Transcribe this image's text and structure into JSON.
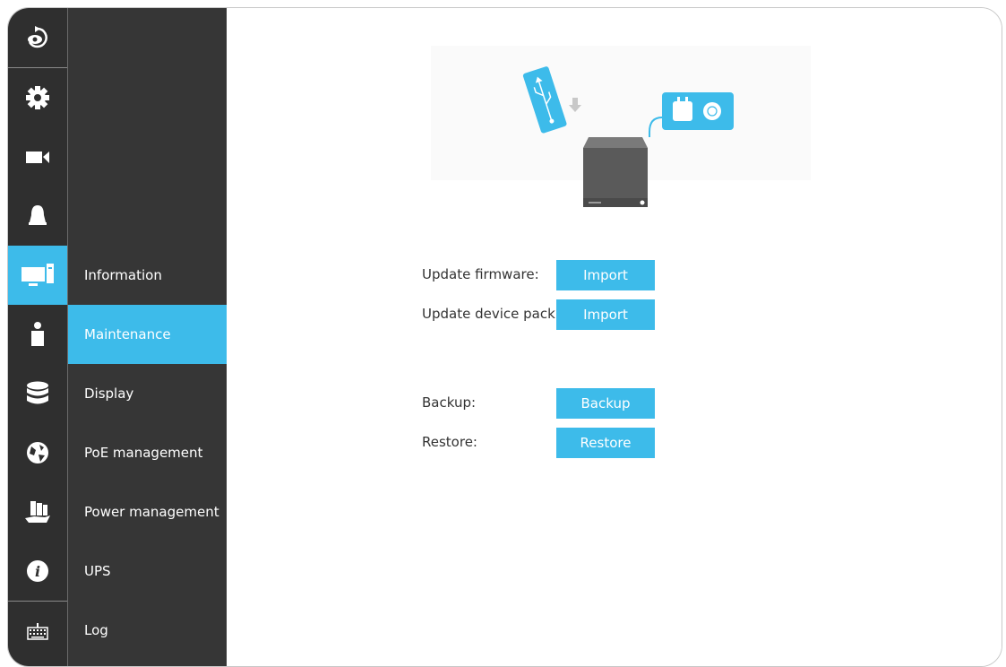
{
  "rail": {
    "items": [
      {
        "icon": "back-eye-icon"
      },
      {
        "icon": "gear-icon"
      },
      {
        "icon": "video-camera-icon"
      },
      {
        "icon": "bell-icon"
      },
      {
        "icon": "computer-icon"
      },
      {
        "icon": "user-icon"
      },
      {
        "icon": "database-icon"
      },
      {
        "icon": "globe-icon"
      },
      {
        "icon": "storage-hand-icon"
      },
      {
        "icon": "info-icon"
      },
      {
        "icon": "keyboard-icon"
      }
    ],
    "active_index": 4
  },
  "submenu": {
    "items": [
      {
        "label": "Information"
      },
      {
        "label": "Maintenance"
      },
      {
        "label": "Display"
      },
      {
        "label": "PoE management"
      },
      {
        "label": "Power management"
      },
      {
        "label": "UPS"
      },
      {
        "label": "Log"
      }
    ],
    "active_index": 1
  },
  "maintenance": {
    "illustration": "nvr-device-with-usb-and-power-icon",
    "firmware": {
      "label": "Update firmware:",
      "button": "Import"
    },
    "device_pack": {
      "label": "Update device pack:",
      "button": "Import"
    },
    "backup": {
      "label": "Backup:",
      "button": "Backup"
    },
    "restore": {
      "label": "Restore:",
      "button": "Restore"
    }
  },
  "colors": {
    "accent": "#3dbbea",
    "rail_bg": "#2f2f2f",
    "submenu_bg": "#363636"
  }
}
